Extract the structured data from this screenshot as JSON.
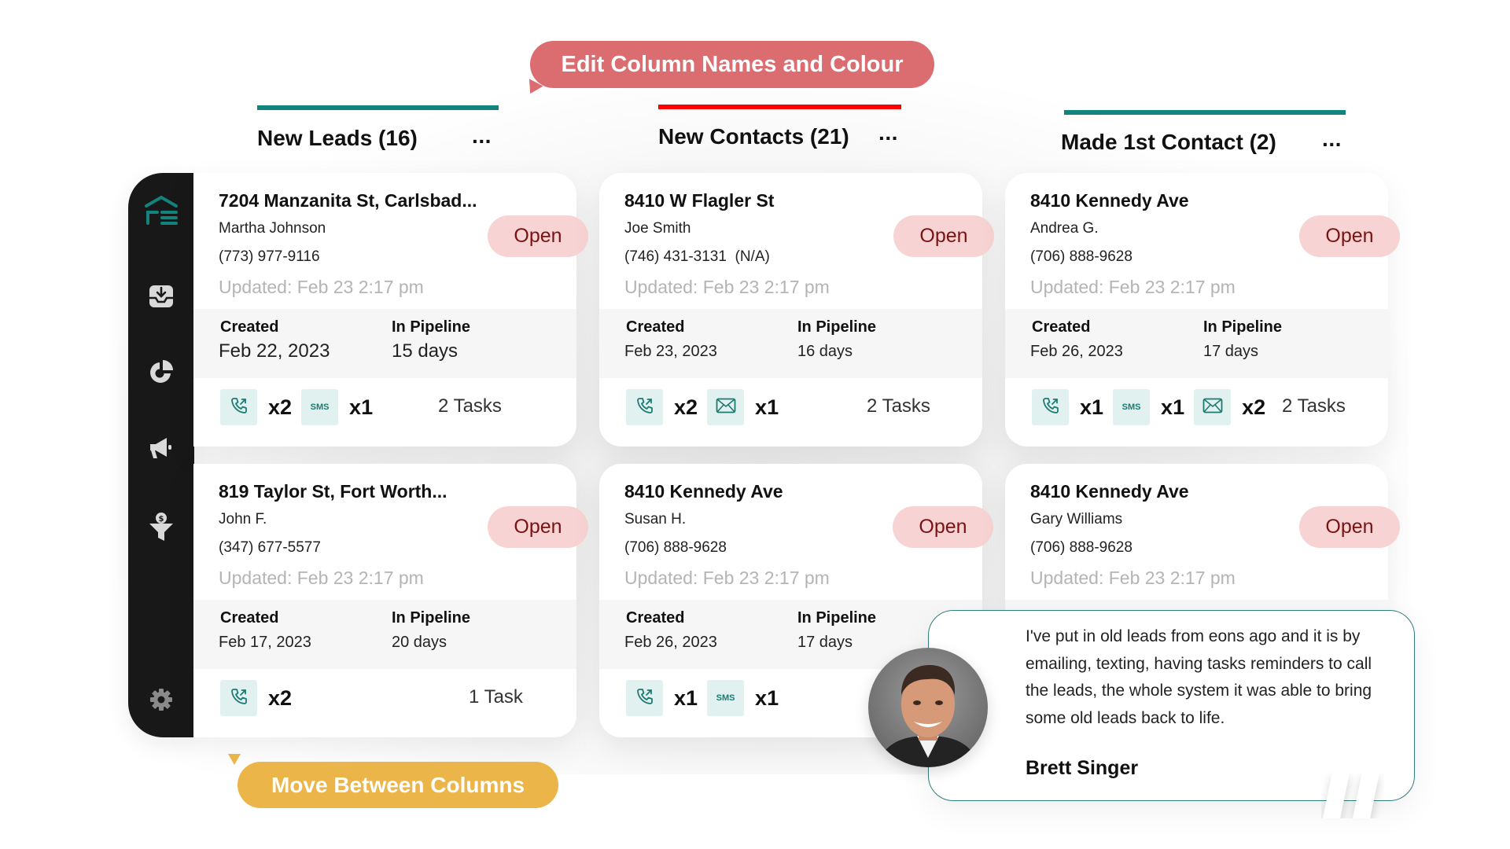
{
  "callouts": {
    "edit_columns": "Edit Column Names and Colour",
    "move_columns": "Move Between Columns"
  },
  "colors": {
    "teal": "#13837d",
    "red": "#ff0000",
    "callout_red": "#db6c70",
    "callout_yellow": "#ecb54a",
    "badge_bg": "#f7d3d4",
    "badge_text": "#7a1212",
    "sidebar_bg": "#181818"
  },
  "sidebar": {
    "items": [
      {
        "icon": "logo-icon"
      },
      {
        "icon": "inbox-download-icon"
      },
      {
        "icon": "pie-chart-icon"
      },
      {
        "icon": "megaphone-icon"
      },
      {
        "icon": "funnel-dollar-icon"
      },
      {
        "icon": "gear-icon"
      }
    ]
  },
  "columns": [
    {
      "title": "New Leads (16)",
      "more": "···",
      "bar_color": "#13837d",
      "cards": [
        {
          "address": "7204 Manzanita St, Carlsbad...",
          "name": "Martha Johnson",
          "phone": "(773) 977-9116",
          "updated": "Updated: Feb 23 2:17 pm",
          "status": "Open",
          "created_label": "Created",
          "created": "Feb 22, 2023",
          "pipeline_label": "In Pipeline",
          "pipeline": "15 days",
          "actions": [
            {
              "type": "call",
              "count": "x2"
            },
            {
              "type": "sms",
              "label": "SMS",
              "count": "x1"
            }
          ],
          "tasks": "2 Tasks"
        },
        {
          "address": "819 Taylor St, Fort Worth...",
          "name": "John F.",
          "phone": "(347) 677-5577",
          "updated": "Updated: Feb 23 2:17 pm",
          "status": "Open",
          "created_label": "Created",
          "created": "Feb 17, 2023",
          "pipeline_label": "In Pipeline",
          "pipeline": "20 days",
          "actions": [
            {
              "type": "call",
              "count": "x2"
            }
          ],
          "tasks": "1 Task"
        }
      ]
    },
    {
      "title": "New Contacts (21)",
      "more": "···",
      "bar_color": "#ff0000",
      "cards": [
        {
          "address": "8410 W Flagler St",
          "name": "Joe Smith",
          "phone": "(746) 431-3131  (N/A)",
          "updated": "Updated: Feb 23 2:17 pm",
          "status": "Open",
          "created_label": "Created",
          "created": "Feb 23, 2023",
          "pipeline_label": "In Pipeline",
          "pipeline": "16 days",
          "actions": [
            {
              "type": "call",
              "count": "x2"
            },
            {
              "type": "email",
              "count": "x1"
            }
          ],
          "tasks": "2 Tasks"
        },
        {
          "address": "8410 Kennedy Ave",
          "name": "Susan H.",
          "phone": "(706) 888-9628",
          "updated": "Updated: Feb 23 2:17 pm",
          "status": "Open",
          "created_label": "Created",
          "created": "Feb 26, 2023",
          "pipeline_label": "In Pipeline",
          "pipeline": "17 days",
          "actions": [
            {
              "type": "call",
              "count": "x1"
            },
            {
              "type": "sms",
              "label": "SMS",
              "count": "x1"
            }
          ],
          "tasks": ""
        }
      ]
    },
    {
      "title": "Made 1st Contact (2)",
      "more": "···",
      "bar_color": "#13837d",
      "cards": [
        {
          "address": "8410 Kennedy Ave",
          "name": "Andrea G.",
          "phone": "(706) 888-9628",
          "updated": "Updated: Feb 23 2:17 pm",
          "status": "Open",
          "created_label": "Created",
          "created": "Feb 26, 2023",
          "pipeline_label": "In Pipeline",
          "pipeline": "17 days",
          "actions": [
            {
              "type": "call",
              "count": "x1"
            },
            {
              "type": "sms",
              "label": "SMS",
              "count": "x1"
            },
            {
              "type": "email",
              "count": "x2"
            }
          ],
          "tasks": "2 Tasks"
        },
        {
          "address": "8410 Kennedy Ave",
          "name": "Gary Williams",
          "phone": "(706) 888-9628",
          "updated": "Updated: Feb 23 2:17 pm",
          "status": "Open"
        }
      ]
    }
  ],
  "testimonial": {
    "text": "I've put in old leads from eons ago and it is by emailing, texting, having tasks reminders to call the leads, the whole system it was able to bring some old leads back to life.",
    "author": "Brett Singer"
  }
}
